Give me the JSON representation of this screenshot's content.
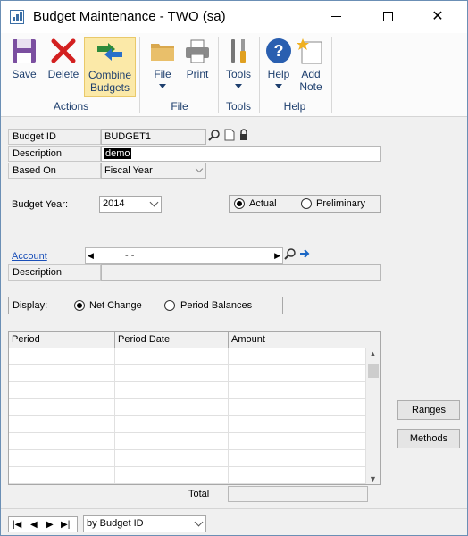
{
  "window": {
    "title": "Budget Maintenance  -  TWO (sa)"
  },
  "ribbon": {
    "buttons": {
      "save": "Save",
      "delete": "Delete",
      "combine_line1": "Combine",
      "combine_line2": "Budgets",
      "file": "File",
      "print": "Print",
      "tools": "Tools",
      "help": "Help",
      "add_note_line1": "Add",
      "add_note_line2": "Note"
    },
    "groups": {
      "actions": "Actions",
      "file": "File",
      "tools": "Tools",
      "help": "Help"
    }
  },
  "form": {
    "budget_id_label": "Budget ID",
    "budget_id_value": "BUDGET1",
    "description_label": "Description",
    "description_value": "demo",
    "based_on_label": "Based On",
    "based_on_value": "Fiscal Year",
    "budget_year_label": "Budget Year:",
    "budget_year_value": "2014",
    "actual_label": "Actual",
    "preliminary_label": "Preliminary",
    "account_label": "Account",
    "account_value": "-         -",
    "account_description_label": "Description",
    "display_label": "Display:",
    "net_change_label": "Net Change",
    "period_balances_label": "Period Balances"
  },
  "grid": {
    "columns": [
      "Period",
      "Period Date",
      "Amount"
    ],
    "total_label": "Total"
  },
  "side_buttons": {
    "ranges": "Ranges",
    "methods": "Methods"
  },
  "bottom": {
    "sort_value": "by Budget ID"
  },
  "colors": {
    "accent": "#1e3f6e",
    "combine_highlight": "#fbe9a8",
    "link": "#1a4fb8"
  }
}
